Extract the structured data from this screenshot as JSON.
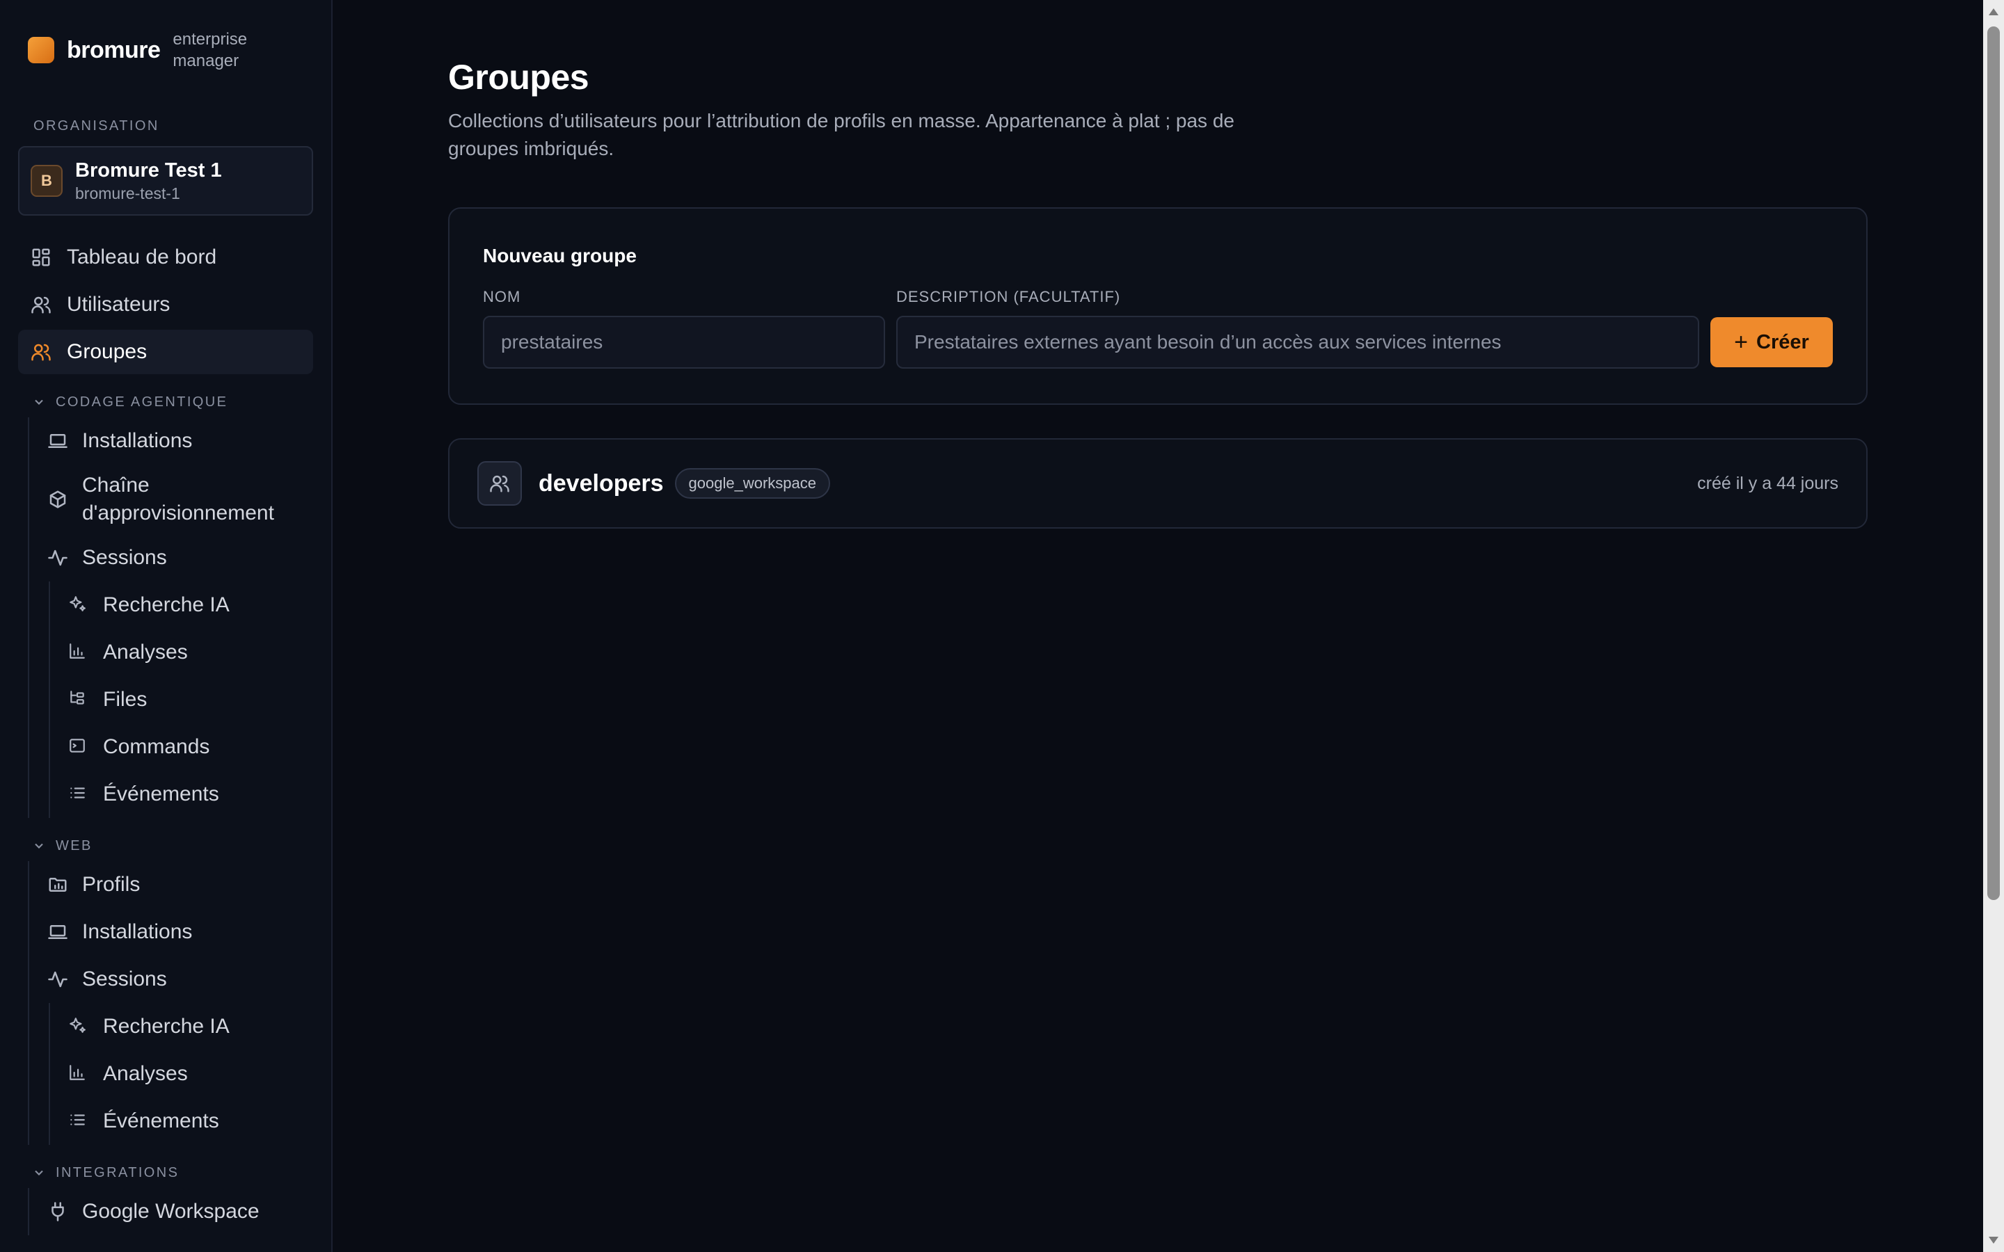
{
  "brand": {
    "name": "bromure",
    "sub": "enterprise manager"
  },
  "org": {
    "section_label": "ORGANISATION",
    "initial": "B",
    "name": "Bromure Test 1",
    "slug": "bromure-test-1"
  },
  "nav": {
    "dashboard": "Tableau de bord",
    "users": "Utilisateurs",
    "groups": "Groupes"
  },
  "agentic": {
    "label": "CODAGE AGENTIQUE",
    "installations": "Installations",
    "supply_chain": "Chaîne d'approvisionnement",
    "sessions": "Sessions",
    "ai_search": "Recherche IA",
    "analyses": "Analyses",
    "files": "Files",
    "commands": "Commands",
    "events": "Événements"
  },
  "web": {
    "label": "WEB",
    "profiles": "Profils",
    "installations": "Installations",
    "sessions": "Sessions",
    "ai_search": "Recherche IA",
    "analyses": "Analyses",
    "events": "Événements"
  },
  "integrations": {
    "label": "INTEGRATIONS",
    "google_workspace": "Google Workspace"
  },
  "page": {
    "title": "Groupes",
    "description": "Collections d’utilisateurs pour l’attribution de profils en masse. Appartenance à plat ; pas de groupes imbriqués."
  },
  "new_group": {
    "title": "Nouveau groupe",
    "name_label": "NOM",
    "name_placeholder": "prestataires",
    "desc_label": "DESCRIPTION (FACULTATIF)",
    "desc_placeholder": "Prestataires externes ayant besoin d’un accès aux services internes",
    "create_button": "Créer"
  },
  "groups": [
    {
      "name": "developers",
      "tag": "google_workspace",
      "meta": "créé il y a 44 jours"
    }
  ],
  "colors": {
    "accent": "#ef8a2c",
    "background": "#090c14",
    "sidebar": "#0c101a"
  }
}
